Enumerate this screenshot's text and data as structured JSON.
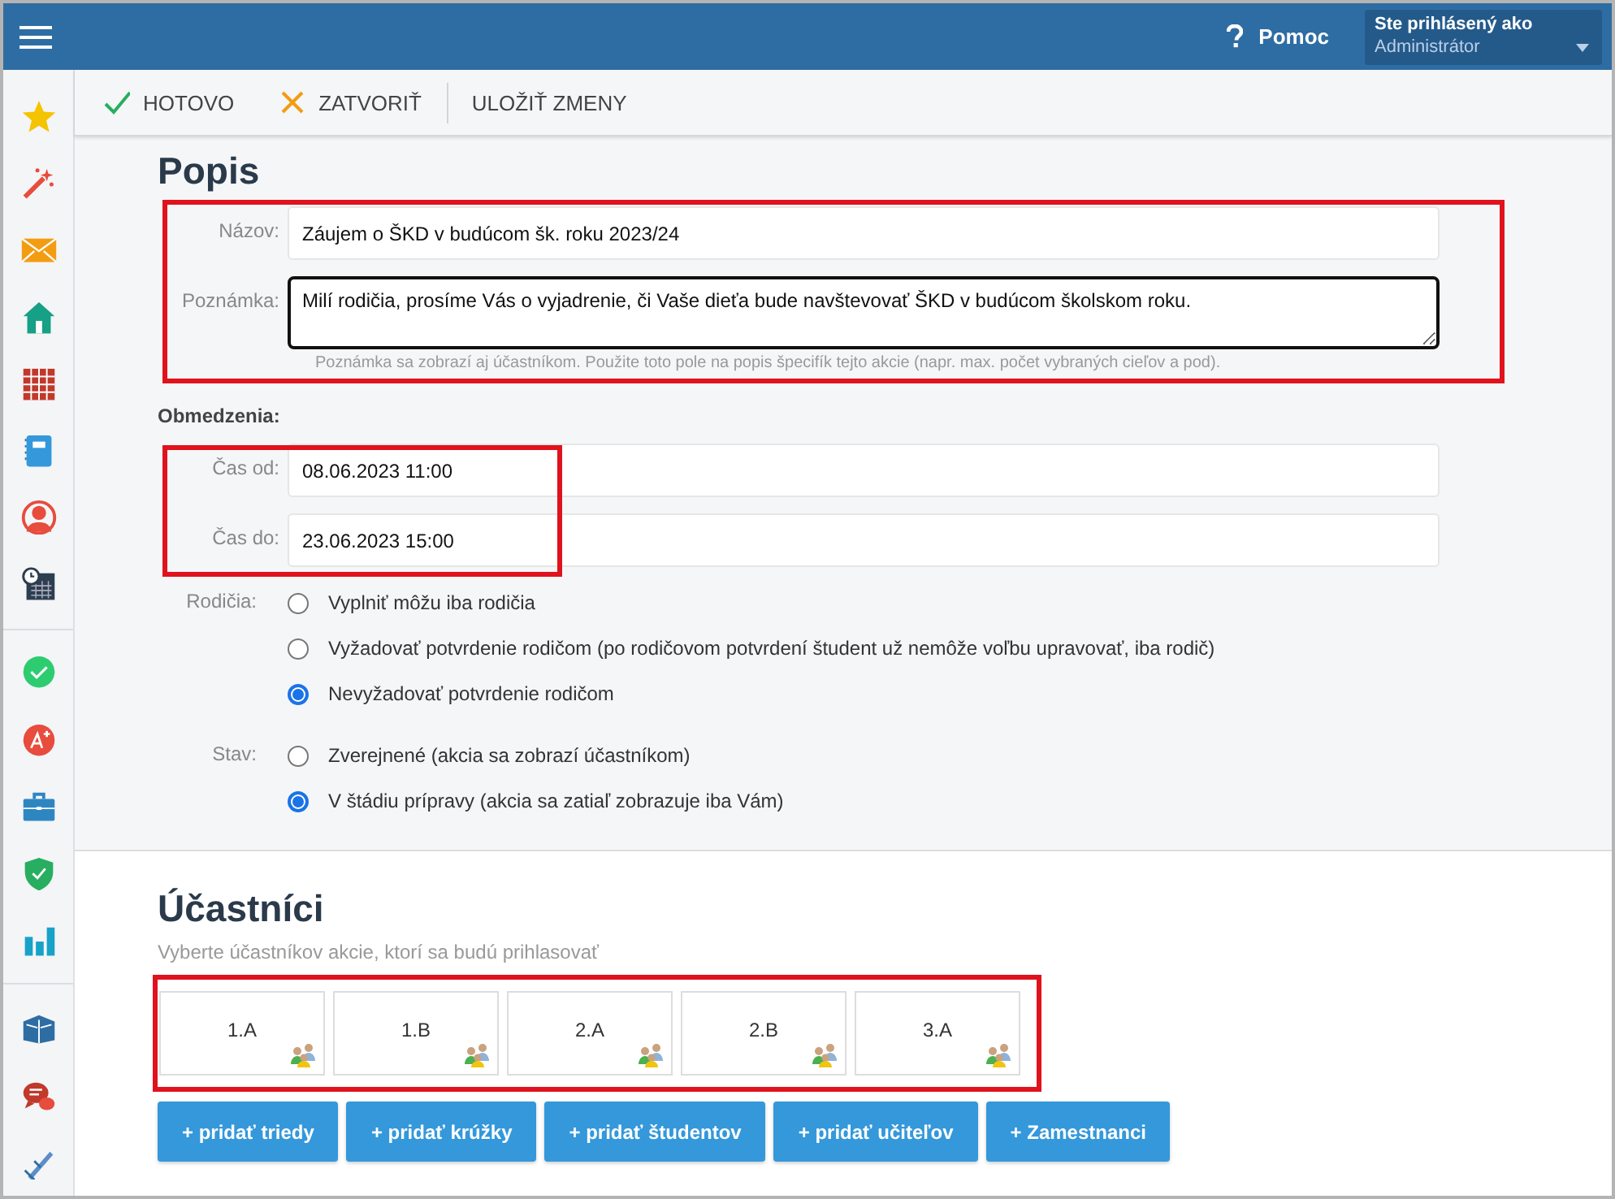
{
  "topbar": {
    "help": "Pomoc",
    "user_label": "Ste prihlásený ako",
    "user_role": "Administrátor"
  },
  "toolbar": [
    {
      "kind": "done",
      "label": "HOTOVO"
    },
    {
      "kind": "close",
      "label": "ZATVORIŤ"
    },
    {
      "kind": "save",
      "label": "ULOŽIŤ ZMENY"
    }
  ],
  "description": {
    "title": "Popis",
    "highlighted": true,
    "name_label": "Názov:",
    "name_value": "Záujem o ŠKD v budúcom šk. roku 2023/24",
    "note_label": "Poznámka:",
    "note_value": "Milí rodičia, prosíme Vás o vyjadrenie, či Vaše dieťa bude navštevovať ŠKD v budúcom školskom roku.",
    "note_hint": "Poznámka sa zobrazí aj účastníkom. Použite toto pole na popis špecifík tejto akcie (napr. max. počet vybraných cieľov a pod)."
  },
  "limits": {
    "title": "Obmedzenia:",
    "highlighted": true,
    "from_label": "Čas od:",
    "from_value": "08.06.2023 11:00",
    "to_label": "Čas do:",
    "to_value": "23.06.2023 15:00"
  },
  "radio_groups": [
    {
      "label": "Rodičia:",
      "options": [
        {
          "label": "Vyplniť môžu iba rodičia",
          "selected": false
        },
        {
          "label": "Vyžadovať potvrdenie rodičom (po rodičovom potvrdení študent už nemôže voľbu upravovať, iba rodič)",
          "selected": false
        },
        {
          "label": "Nevyžadovať potvrdenie rodičom",
          "selected": true
        }
      ]
    },
    {
      "label": "Stav:",
      "options": [
        {
          "label": "Zverejnené (akcia sa zobrazí účastníkom)",
          "selected": false
        },
        {
          "label": "V štádiu prípravy (akcia sa zatiaľ zobrazuje iba Vám)",
          "selected": true
        }
      ]
    }
  ],
  "participants": {
    "title": "Účastníci",
    "subtitle": "Vyberte účastníkov akcie, ktorí sa budú prihlasovať",
    "highlighted": true,
    "groups": [
      "1.A",
      "1.B",
      "2.A",
      "2.B",
      "3.A"
    ],
    "buttons": [
      "+ pridať triedy",
      "+ pridať krúžky",
      "+ pridať študentov",
      "+ pridať učiteľov",
      "+ Zamestnanci"
    ]
  }
}
